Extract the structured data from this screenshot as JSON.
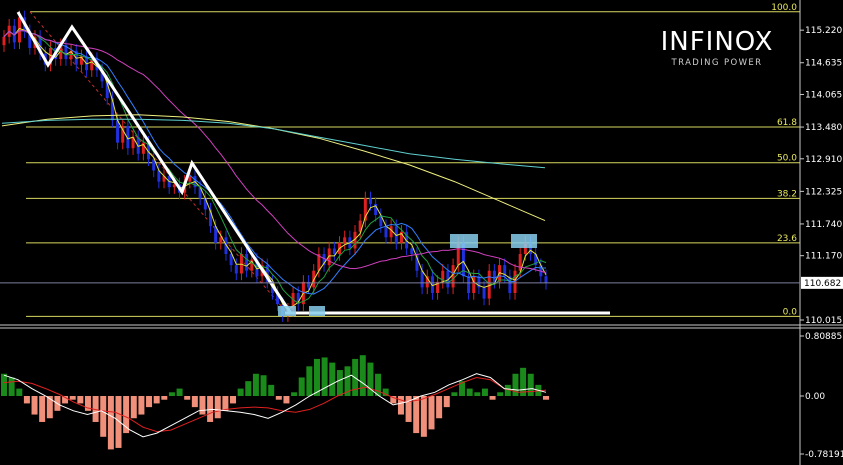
{
  "logo": {
    "name": "INFINOX",
    "tagline": "TRADING POWER"
  },
  "chart_data": [
    {
      "type": "candlestick",
      "ylim": [
        110.015,
        115.6
      ],
      "y_ticks": [
        "115.220",
        "114.635",
        "114.065",
        "113.480",
        "112.910",
        "112.325",
        "111.740",
        "111.170",
        "110.015"
      ],
      "current_price": "110.682",
      "fibonacci_levels": [
        {
          "label": "100.0",
          "price": 115.55
        },
        {
          "label": "61.8",
          "price": 113.48
        },
        {
          "label": "50.0",
          "price": 112.84
        },
        {
          "label": "38.2",
          "price": 112.2
        },
        {
          "label": "23.6",
          "price": 111.4
        },
        {
          "label": "0.0",
          "price": 110.08
        }
      ],
      "candles_close": [
        115.1,
        115.3,
        115.0,
        115.45,
        115.2,
        114.9,
        115.1,
        114.8,
        114.6,
        114.9,
        114.7,
        114.95,
        114.7,
        114.85,
        114.6,
        114.75,
        114.5,
        114.7,
        114.5,
        114.3,
        114.0,
        113.6,
        113.2,
        113.5,
        113.1,
        113.3,
        113.0,
        113.2,
        112.9,
        112.7,
        112.5,
        112.6,
        112.4,
        112.45,
        112.3,
        112.5,
        112.6,
        112.4,
        112.2,
        112.0,
        111.7,
        111.4,
        111.5,
        111.2,
        111.0,
        110.85,
        111.2,
        110.9,
        111.1,
        110.8,
        111.0,
        110.7,
        110.5,
        110.3,
        110.1,
        110.2,
        110.5,
        110.3,
        110.7,
        110.6,
        110.9,
        111.2,
        111.0,
        111.3,
        111.2,
        111.4,
        111.5,
        111.3,
        111.6,
        111.8,
        112.2,
        112.1,
        111.9,
        111.7,
        111.5,
        111.7,
        111.4,
        111.6,
        111.3,
        111.2,
        110.9,
        110.6,
        110.8,
        110.5,
        110.7,
        110.9,
        110.6,
        111.0,
        111.4,
        110.8,
        110.5,
        110.8,
        110.6,
        110.4,
        110.9,
        110.7,
        111.0,
        110.8,
        110.5,
        110.9,
        111.2,
        111.4,
        111.2,
        111.0,
        110.8,
        110.68
      ]
    },
    {
      "type": "histogram",
      "ylim": [
        -0.78191,
        0.80885
      ],
      "y_ticks": [
        "0.80885",
        "0.00",
        "-0.78191"
      ],
      "values": [
        0.3,
        0.25,
        0.1,
        -0.1,
        -0.25,
        -0.35,
        -0.3,
        -0.2,
        -0.1,
        -0.05,
        -0.1,
        -0.2,
        -0.35,
        -0.55,
        -0.72,
        -0.7,
        -0.5,
        -0.3,
        -0.25,
        -0.15,
        -0.1,
        -0.05,
        0.05,
        0.1,
        -0.05,
        -0.15,
        -0.25,
        -0.35,
        -0.3,
        -0.2,
        -0.1,
        0.1,
        0.2,
        0.3,
        0.28,
        0.15,
        -0.05,
        -0.1,
        0.05,
        0.25,
        0.4,
        0.5,
        0.52,
        0.45,
        0.35,
        0.4,
        0.5,
        0.55,
        0.45,
        0.3,
        0.1,
        -0.1,
        -0.25,
        -0.35,
        -0.5,
        -0.55,
        -0.45,
        -0.3,
        -0.15,
        0.05,
        0.2,
        0.1,
        0.05,
        0.1,
        -0.05,
        0.05,
        0.15,
        0.3,
        0.38,
        0.3,
        0.15,
        -0.05
      ],
      "signal_line": [
        0.18,
        0.2,
        0.17,
        0.1,
        0.02,
        -0.08,
        -0.16,
        -0.2,
        -0.22,
        -0.3,
        -0.42,
        -0.48,
        -0.46,
        -0.38,
        -0.3,
        -0.22,
        -0.18,
        -0.16,
        -0.15,
        -0.16,
        -0.2,
        -0.22,
        -0.18,
        -0.1,
        0.0,
        0.08,
        0.12,
        0.06,
        -0.02,
        -0.08,
        -0.05,
        0.02,
        0.1,
        0.18,
        0.25,
        0.22,
        0.1,
        0.05,
        0.06,
        0.08
      ],
      "macd_line": [
        0.28,
        0.22,
        0.1,
        0.0,
        -0.12,
        -0.2,
        -0.25,
        -0.2,
        -0.3,
        -0.45,
        -0.55,
        -0.5,
        -0.4,
        -0.3,
        -0.2,
        -0.18,
        -0.2,
        -0.22,
        -0.25,
        -0.3,
        -0.22,
        -0.12,
        0.0,
        0.1,
        0.2,
        0.28,
        0.15,
        0.0,
        -0.12,
        -0.08,
        0.0,
        0.05,
        0.15,
        0.22,
        0.3,
        0.25,
        0.1,
        0.08,
        0.1,
        0.05
      ]
    }
  ]
}
